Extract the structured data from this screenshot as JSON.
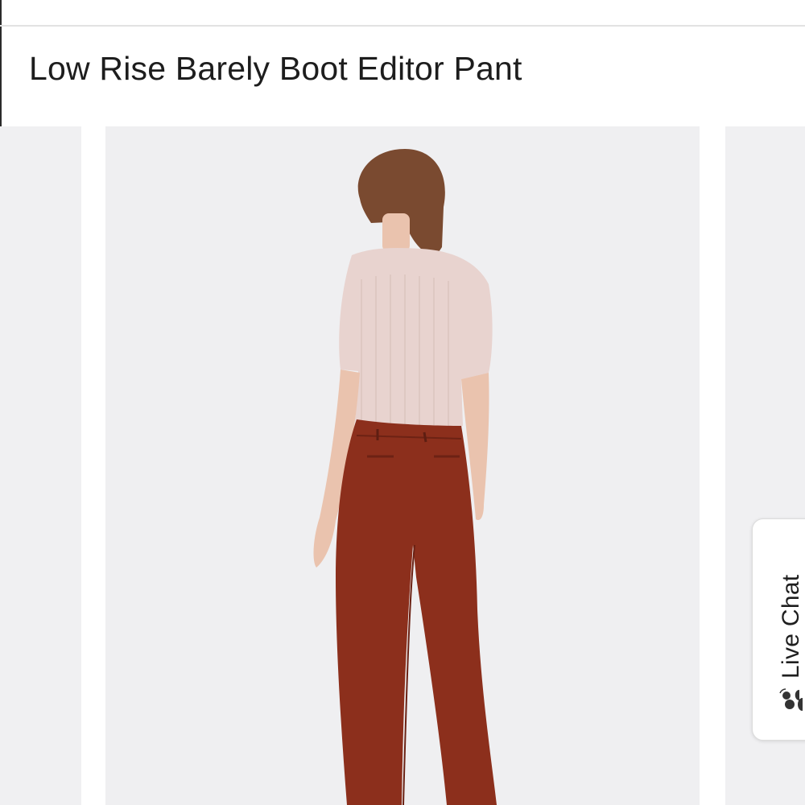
{
  "product": {
    "title": "Low Rise Barely Boot Editor Pant"
  },
  "carousel": {
    "current_image": "model-back-view-rust-pants-icon"
  },
  "live_chat": {
    "label": "Live Chat",
    "icon": "chat-bubble-icon"
  },
  "colors": {
    "pant": "#8c2f1c",
    "top": "#e8d3cf",
    "hair": "#7a4a30",
    "image_bg": "#efeff1"
  }
}
